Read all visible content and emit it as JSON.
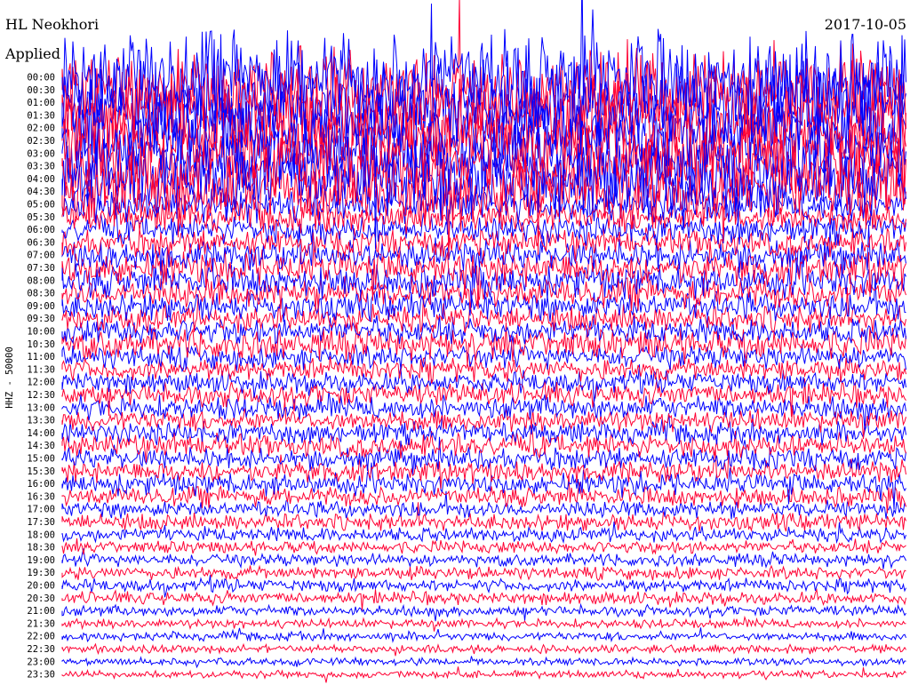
{
  "chart_data": {
    "type": "line",
    "title": "HL Neokhori",
    "subtitle": "Applied",
    "date": "2017-10-05",
    "ylabel": "HHZ - 50000",
    "series_colors": [
      "#0000ff",
      "#ff0033"
    ],
    "categories": [
      "00:00",
      "00:30",
      "01:00",
      "01:30",
      "02:00",
      "02:30",
      "03:00",
      "03:30",
      "04:00",
      "04:30",
      "05:00",
      "05:30",
      "06:00",
      "06:30",
      "07:00",
      "07:30",
      "08:00",
      "08:30",
      "09:00",
      "09:30",
      "10:00",
      "10:30",
      "11:00",
      "11:30",
      "12:00",
      "12:30",
      "13:00",
      "13:30",
      "14:00",
      "14:30",
      "15:00",
      "15:30",
      "16:00",
      "16:30",
      "17:00",
      "17:30",
      "18:00",
      "18:30",
      "19:00",
      "19:30",
      "20:00",
      "20:30",
      "21:00",
      "21:30",
      "22:00",
      "22:30",
      "23:00",
      "23:30"
    ],
    "values": [
      1.0,
      0.95,
      0.92,
      0.9,
      0.88,
      0.85,
      0.85,
      0.82,
      0.8,
      0.75,
      0.35,
      0.3,
      0.28,
      0.26,
      0.3,
      0.35,
      0.32,
      0.3,
      0.28,
      0.26,
      0.25,
      0.3,
      0.22,
      0.2,
      0.2,
      0.22,
      0.22,
      0.2,
      0.2,
      0.22,
      0.2,
      0.2,
      0.2,
      0.18,
      0.15,
      0.15,
      0.12,
      0.1,
      0.1,
      0.1,
      0.1,
      0.1,
      0.08,
      0.06,
      0.06,
      0.05,
      0.04,
      0.04
    ],
    "grid": false,
    "legend": "none"
  }
}
